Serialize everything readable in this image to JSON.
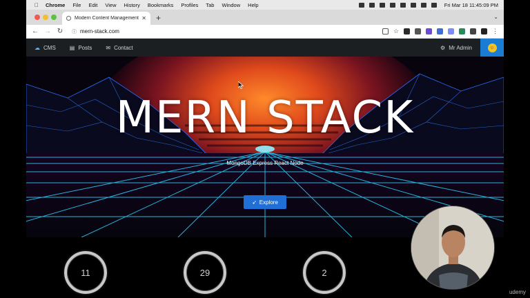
{
  "menubar": {
    "app_name": "Chrome",
    "items": [
      "File",
      "Edit",
      "View",
      "History",
      "Bookmarks",
      "Profiles",
      "Tab",
      "Window",
      "Help"
    ],
    "clock": "Fri Mar 18  11:45:09 PM"
  },
  "browser": {
    "tab_title": "Modern Content Management",
    "url": "mern-stack.com"
  },
  "site_nav": {
    "brand": "CMS",
    "links": [
      "Posts",
      "Contact"
    ],
    "admin_label": "Mr Admin"
  },
  "hero": {
    "title": "MERN STACK",
    "subtitle": "MongoDB Express React Node",
    "button_label": "Explore"
  },
  "stats": [
    {
      "value": "11"
    },
    {
      "value": "29"
    },
    {
      "value": "2"
    }
  ],
  "watermark": "udemy",
  "colors": {
    "nav_background": "#1c1f22",
    "button_blue": "#1f6fd6",
    "avatar_box": "#1a7cd3",
    "grid_cyan": "#2ad4ff",
    "sunset_red": "#c8341c"
  },
  "icons": {
    "brand": "cloud-icon",
    "posts": "document-icon",
    "contact": "envelope-icon",
    "admin": "gear-icon",
    "explore": "send-icon"
  }
}
